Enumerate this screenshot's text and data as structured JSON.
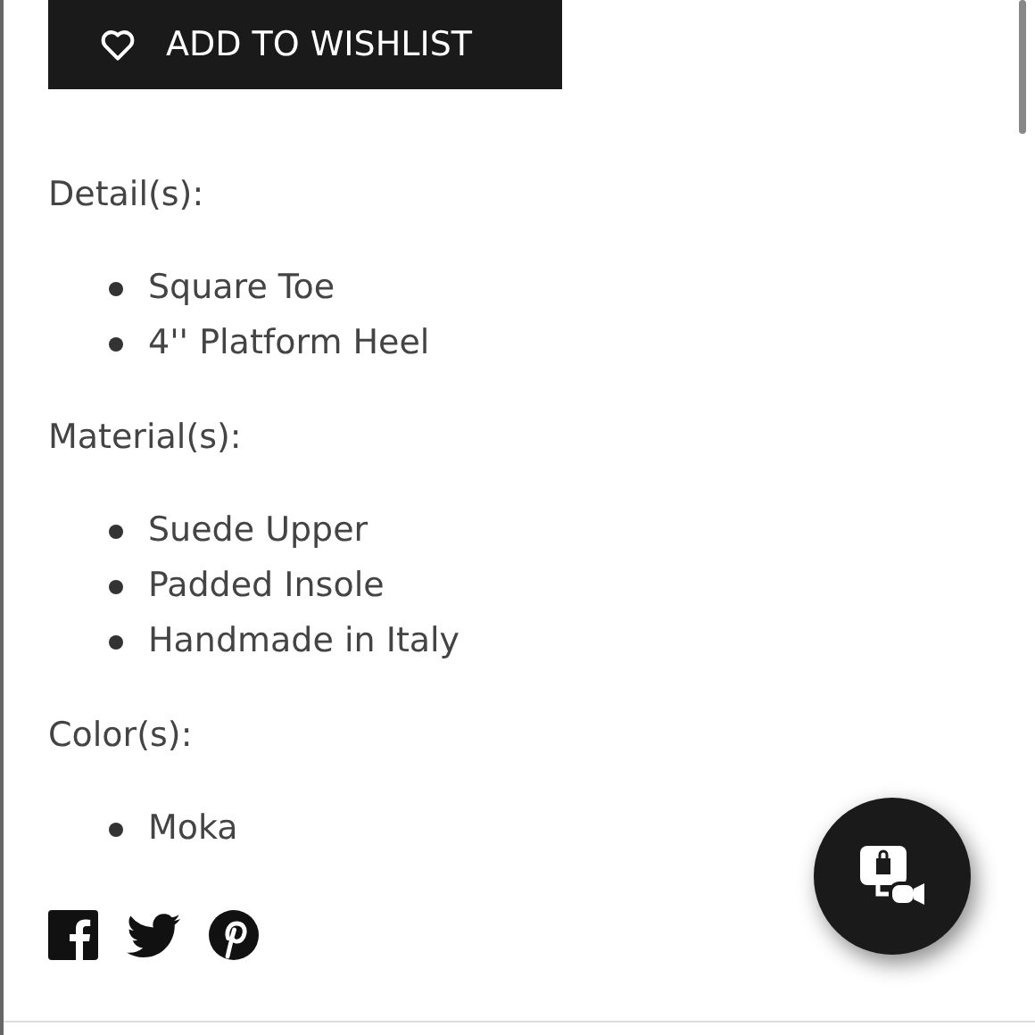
{
  "wishlist_button": {
    "label": "ADD TO WISHLIST"
  },
  "sections": [
    {
      "heading": "Detail(s):",
      "items": [
        "Square Toe",
        "4'' Platform Heel"
      ]
    },
    {
      "heading": "Material(s):",
      "items": [
        "Suede Upper",
        "Padded Insole",
        "Handmade in Italy"
      ]
    },
    {
      "heading": "Color(s):",
      "items": [
        "Moka"
      ]
    }
  ]
}
